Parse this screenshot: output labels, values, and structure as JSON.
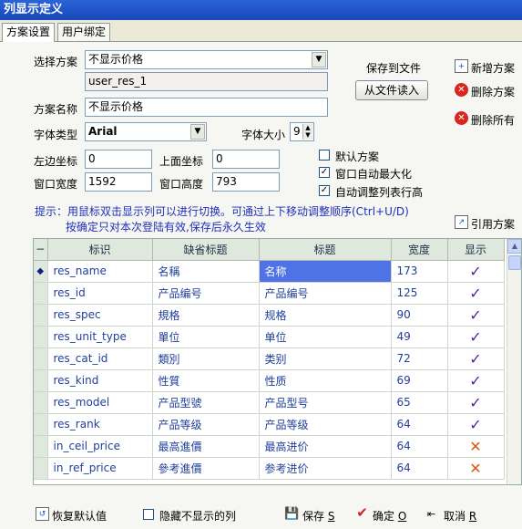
{
  "window": {
    "title": "列显示定义"
  },
  "tabs": [
    {
      "label": "方案设置",
      "active": true
    },
    {
      "label": "用户绑定",
      "active": false
    }
  ],
  "form": {
    "scheme_label": "选择方案",
    "scheme_value": "不显示价格",
    "scheme_id": "user_res_1",
    "name_label": "方案名称",
    "name_value": "不显示价格",
    "font_type_label": "字体类型",
    "font_type_value": "Arial",
    "font_size_label": "字体大小",
    "font_size_value": "9",
    "left_label": "左边坐标",
    "left_value": "0",
    "top_label": "上面坐标",
    "top_value": "0",
    "width_label": "窗口宽度",
    "width_value": "1592",
    "height_label": "窗口高度",
    "height_value": "793"
  },
  "actions": {
    "save_to_file": "保存到文件",
    "load_from_file": "从文件读入",
    "add_scheme": "新增方案",
    "delete_scheme": "删除方案",
    "delete_all": "删除所有",
    "reference_scheme": "引用方案"
  },
  "options": {
    "default_scheme": {
      "label": "默认方案",
      "checked": false
    },
    "auto_maximize": {
      "label": "窗口自动最大化",
      "checked": true
    },
    "auto_row_height": {
      "label": "自动调整列表行高",
      "checked": true
    }
  },
  "hint": {
    "line1": "提示：用鼠标双击显示列可以进行切换。可通过上下移动调整顺序(Ctrl+U/D)",
    "line2": "按确定只对本次登陆有效,保存后永久生效"
  },
  "grid": {
    "columns": [
      "−",
      "标识",
      "缺省标题",
      "标题",
      "宽度",
      "显示"
    ],
    "rows": [
      {
        "id": "res_name",
        "default_title": "名稱",
        "title": "名称",
        "width": "173",
        "show": true,
        "current": true
      },
      {
        "id": "res_id",
        "default_title": "产品编号",
        "title": "产品编号",
        "width": "125",
        "show": true
      },
      {
        "id": "res_spec",
        "default_title": "規格",
        "title": "规格",
        "width": "90",
        "show": true
      },
      {
        "id": "res_unit_type",
        "default_title": "單位",
        "title": "单位",
        "width": "49",
        "show": true
      },
      {
        "id": "res_cat_id",
        "default_title": "類別",
        "title": "类别",
        "width": "72",
        "show": true
      },
      {
        "id": "res_kind",
        "default_title": "性質",
        "title": "性质",
        "width": "69",
        "show": true
      },
      {
        "id": "res_model",
        "default_title": "产品型號",
        "title": "产品型号",
        "width": "65",
        "show": true
      },
      {
        "id": "res_rank",
        "default_title": "产品等级",
        "title": "产品等级",
        "width": "64",
        "show": true
      },
      {
        "id": "in_ceil_price",
        "default_title": "最高進價",
        "title": "最高进价",
        "width": "64",
        "show": false
      },
      {
        "id": "in_ref_price",
        "default_title": "參考進價",
        "title": "参考进价",
        "width": "64",
        "show": false
      }
    ]
  },
  "bottom": {
    "restore_default": "恢复默认值",
    "hide_hidden_cols": "隐藏不显示的列",
    "save": "保存",
    "save_key": "S",
    "ok": "确定",
    "ok_key": "O",
    "cancel": "取消",
    "cancel_key": "R"
  },
  "icons": {
    "scheme-dropdown": "chevron-down-icon",
    "font-dropdown": "chevron-down-icon",
    "add": "add-doc-icon",
    "delete": "delete-icon",
    "check": "check-icon",
    "cross": "cross-icon"
  },
  "colors": {
    "title_bar": "#1e52c8",
    "hint_text": "#1f30b8",
    "selected_cell": "#4f72e6",
    "check_mark": "#5a22a8",
    "cross_mark": "#d45a10",
    "delete_icon": "#d8261f"
  }
}
